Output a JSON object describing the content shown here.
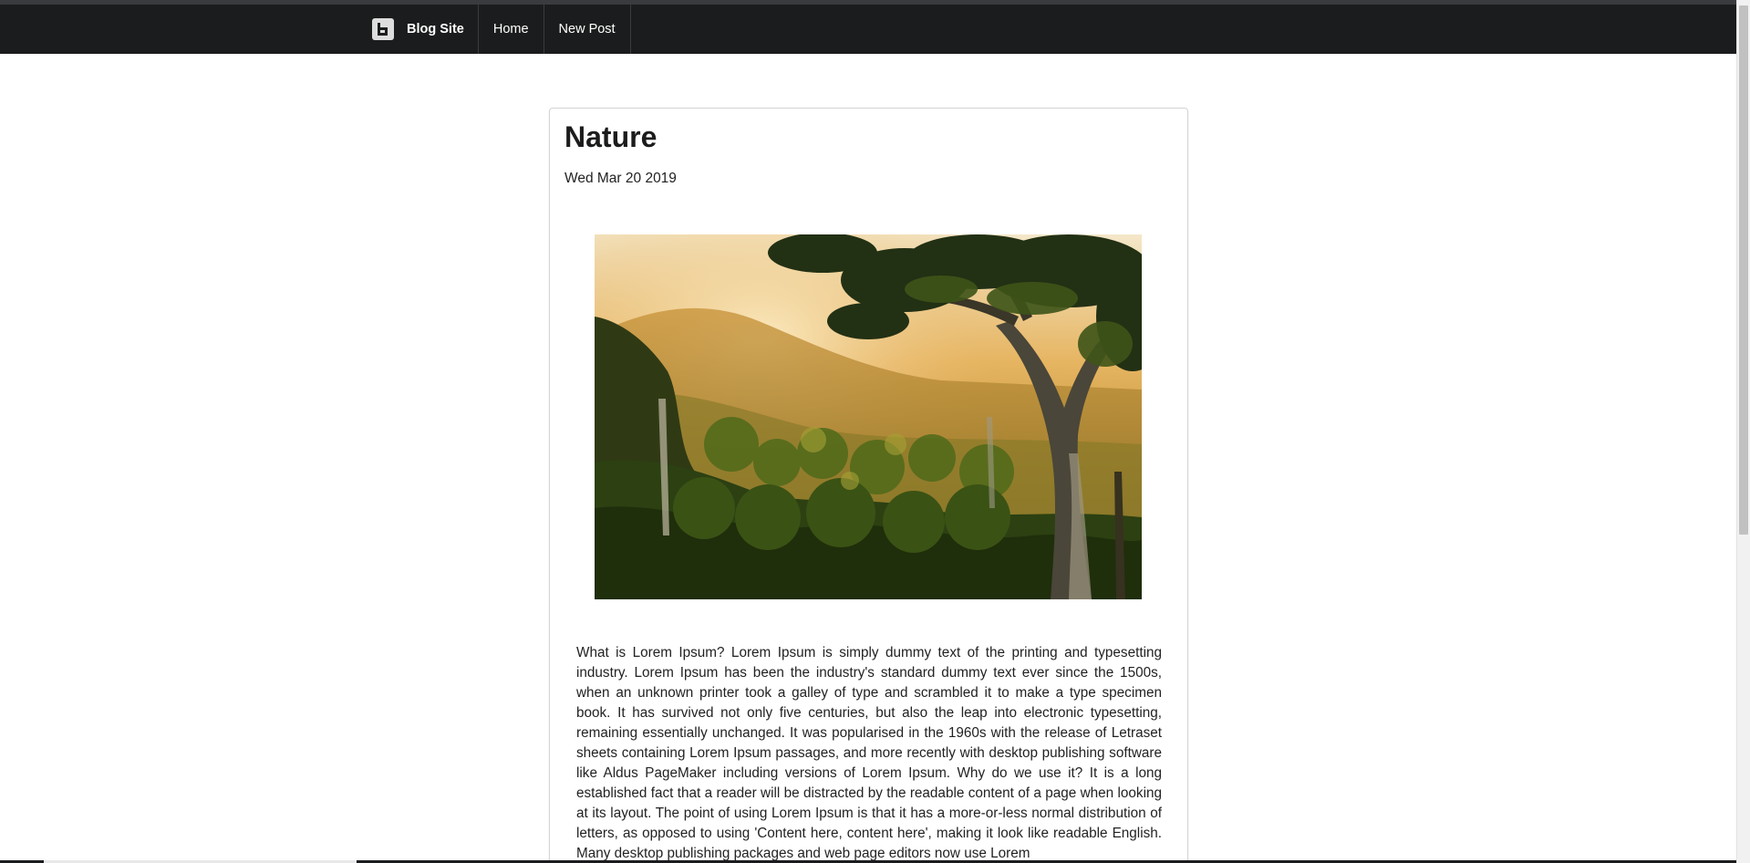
{
  "nav": {
    "brand": "Blog Site",
    "links": [
      "Home",
      "New Post"
    ]
  },
  "post": {
    "title": "Nature",
    "date": "Wed Mar 20 2019",
    "image_subject": "sunlit forest valley with large tree",
    "body": "What is Lorem Ipsum? Lorem Ipsum is simply dummy text of the printing and typesetting industry. Lorem Ipsum has been the industry's standard dummy text ever since the 1500s, when an unknown printer took a galley of type and scrambled it to make a type specimen book. It has survived not only five centuries, but also the leap into electronic typesetting, remaining essentially unchanged. It was popularised in the 1960s with the release of Letraset sheets containing Lorem Ipsum passages, and more recently with desktop publishing software like Aldus PageMaker including versions of Lorem Ipsum. Why do we use it? It is a long established fact that a reader will be distracted by the readable content of a page when looking at its layout. The point of using Lorem Ipsum is that it has a more-or-less normal distribution of letters, as opposed to using 'Content here, content here', making it look like readable English. Many desktop publishing packages and web page editors now use Lorem"
  },
  "colors": {
    "navbar": "#1b1c1d",
    "page_background": "#ffffff",
    "card_border": "#d4d4d5",
    "text": "#222222"
  },
  "icons": {
    "brand_logo": "blog-logo-icon"
  }
}
